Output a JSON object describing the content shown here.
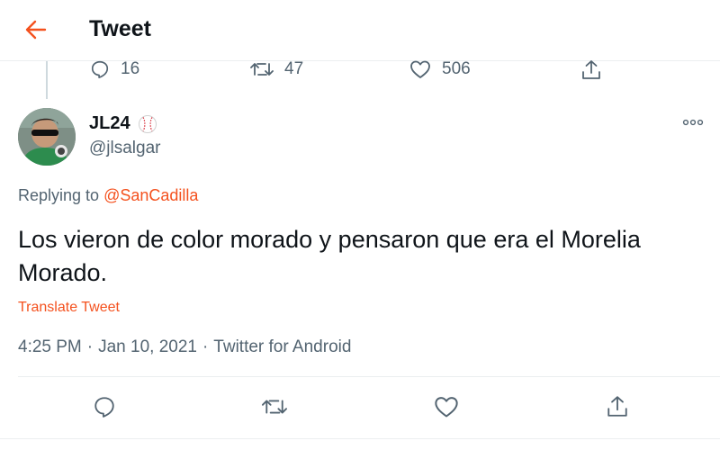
{
  "header": {
    "title": "Tweet",
    "back_icon": "arrow-left-icon",
    "accent_color": "#f4511e"
  },
  "previous_tweet": {
    "replies": "16",
    "retweets": "47",
    "likes": "506"
  },
  "tweet": {
    "author": {
      "display_name": "JL24",
      "badge_icon": "baseball-emoji-icon",
      "handle": "@jlsalgar"
    },
    "replying_prefix": "Replying to",
    "replying_to": "@SanCadilla",
    "text": "Los vieron de color morado y pensaron que era el Morelia Morado.",
    "translate_label": "Translate Tweet",
    "time": "4:25 PM",
    "separator": "·",
    "date": "Jan 10, 2021",
    "client": "Twitter for Android"
  },
  "actions": {
    "reply_icon": "reply-icon",
    "retweet_icon": "retweet-icon",
    "like_icon": "like-heart-icon",
    "share_icon": "share-icon"
  }
}
